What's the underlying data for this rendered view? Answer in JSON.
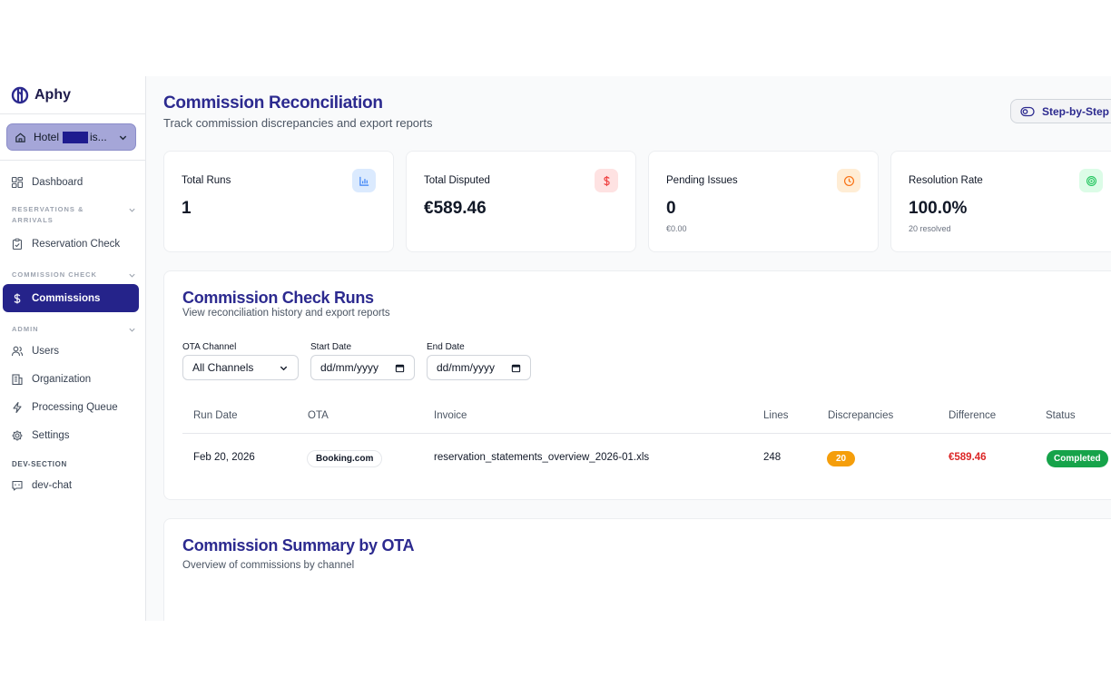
{
  "brand": {
    "name": "Aphy",
    "color": "#2c2a8f"
  },
  "hotel": {
    "prefix": "Hotel",
    "suffix": "is..."
  },
  "nav": {
    "dashboard": "Dashboard",
    "section_reservations": "Reservations & Arrivals",
    "reservation_check": "Reservation Check",
    "section_commission": "Commission Check",
    "commissions": "Commissions",
    "section_admin": "Admin",
    "users": "Users",
    "organization": "Organization",
    "processing_queue": "Processing Queue",
    "settings": "Settings",
    "section_dev": "Dev-Section",
    "dev_chat": "dev-chat"
  },
  "header": {
    "title": "Commission Reconciliation",
    "subtitle": "Track commission discrepancies and export reports",
    "step_button": "Step-by-Step"
  },
  "stats": [
    {
      "label": "Total Runs",
      "value": "1",
      "note": "",
      "icon": "bar-chart-icon",
      "icon_bg": "#dbeafe",
      "icon_color": "#3b82f6"
    },
    {
      "label": "Total Disputed",
      "value": "€589.46",
      "note": "",
      "icon": "dollar-icon",
      "icon_bg": "#fee2e2",
      "icon_color": "#ef4444"
    },
    {
      "label": "Pending Issues",
      "value": "0",
      "note": "€0.00",
      "icon": "clock-icon",
      "icon_bg": "#ffedd5",
      "icon_color": "#f97316"
    },
    {
      "label": "Resolution Rate",
      "value": "100.0%",
      "note": "20 resolved",
      "icon": "target-icon",
      "icon_bg": "#dcfce7",
      "icon_color": "#22c55e"
    }
  ],
  "runs": {
    "title": "Commission Check Runs",
    "subtitle": "View reconciliation history and export reports",
    "filters": {
      "ota_label": "OTA Channel",
      "ota_value": "All Channels",
      "start_label": "Start Date",
      "start_placeholder": "dd/mm/yyyy",
      "end_label": "End Date",
      "end_placeholder": "dd/mm/yyyy"
    },
    "columns": [
      "Run Date",
      "OTA",
      "Invoice",
      "Lines",
      "Discrepancies",
      "Difference",
      "Status"
    ],
    "rows": [
      {
        "run_date": "Feb 20, 2026",
        "ota": "Booking.com",
        "invoice": "reservation_statements_overview_2026-01.xls",
        "lines": "248",
        "discrepancies": "20",
        "difference": "€589.46",
        "status": "Completed"
      }
    ]
  },
  "summary": {
    "title": "Commission Summary by OTA",
    "subtitle": "Overview of commissions by channel"
  }
}
